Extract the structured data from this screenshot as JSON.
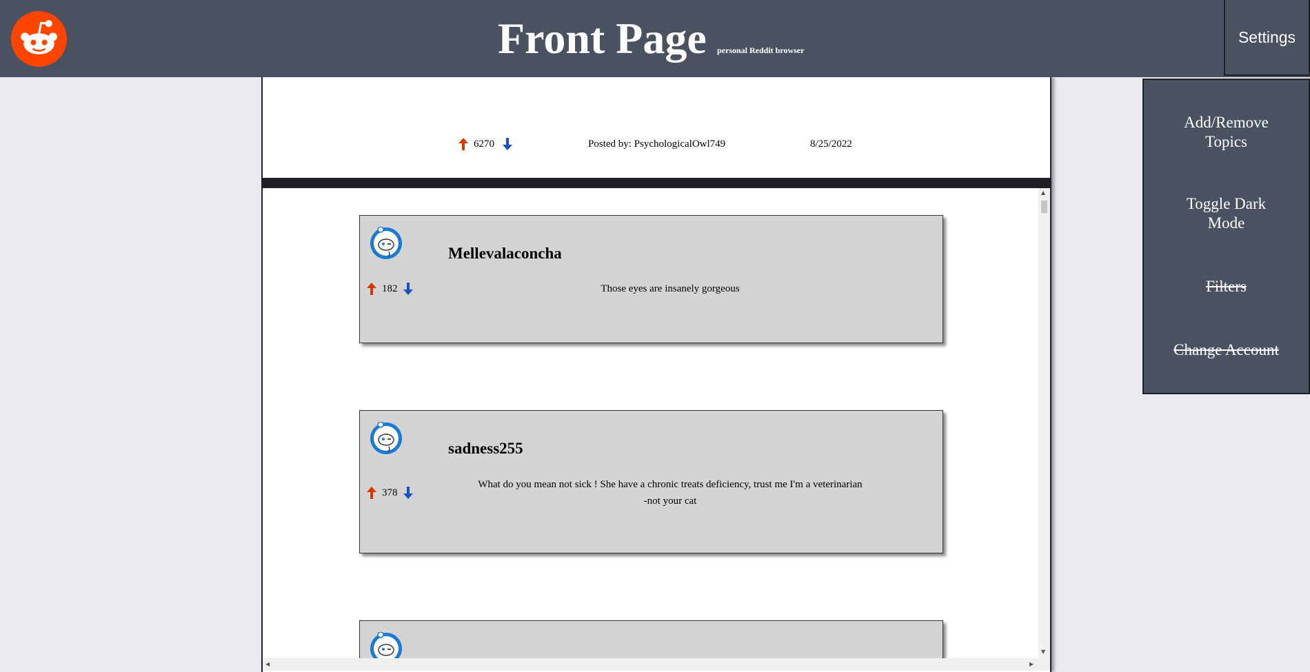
{
  "header": {
    "title": "Front Page",
    "subtitle": "personal Reddit browser",
    "settings_label": "Settings",
    "logo_icon": "reddit-logo-icon"
  },
  "settings_menu": {
    "items": [
      {
        "label": "Add/Remove Topics",
        "struck": false
      },
      {
        "label": "Toggle Dark Mode",
        "struck": false
      },
      {
        "label": "Filters",
        "struck": true
      },
      {
        "label": "Change Account",
        "struck": true
      }
    ]
  },
  "post": {
    "score": "6270",
    "posted_by": "Posted by: PsychologicalOwl749",
    "date": "8/25/2022"
  },
  "comments": [
    {
      "author": "Mellevalaconcha",
      "score": "182",
      "text": "Those eyes are insanely gorgeous"
    },
    {
      "author": "sadness255",
      "score": "378",
      "text": "What do you mean not sick ! She have a chronic treats deficiency, trust me I'm a veterinarian -not your cat"
    },
    {
      "author": "",
      "score": "",
      "text": ""
    }
  ],
  "colors": {
    "header_bg": "#4a5160",
    "upvote": "#d93a00",
    "downvote": "#1b4fc4",
    "comment_bg": "#d4d4d4",
    "page_bg": "#eaeaee"
  }
}
